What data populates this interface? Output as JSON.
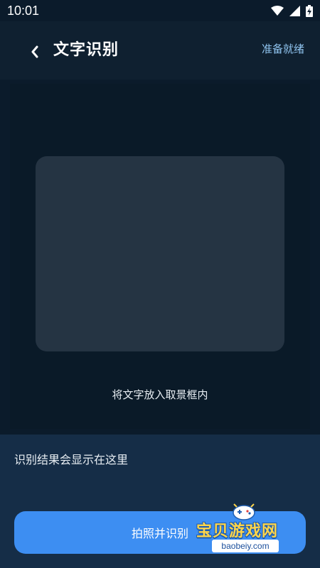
{
  "status_bar": {
    "time": "10:01",
    "icons": [
      "wifi-icon",
      "signal-icon",
      "battery-charging-icon"
    ]
  },
  "header": {
    "back_icon": "chevron-left-icon",
    "title": "文字识别",
    "status": "准备就绪"
  },
  "preview": {
    "hint": "将文字放入取景框内"
  },
  "result": {
    "placeholder": "识别结果会显示在这里"
  },
  "actions": {
    "capture_label": "拍照并识别"
  },
  "watermark": {
    "title": "宝贝游戏网",
    "url": "baobeiy.com"
  },
  "colors": {
    "background": "#0b1b2b",
    "header": "#0f2030",
    "viewfinder": "#253443",
    "result_panel": "#152d47",
    "accent": "#3d8ef2",
    "status_text": "#8fc3ee"
  }
}
